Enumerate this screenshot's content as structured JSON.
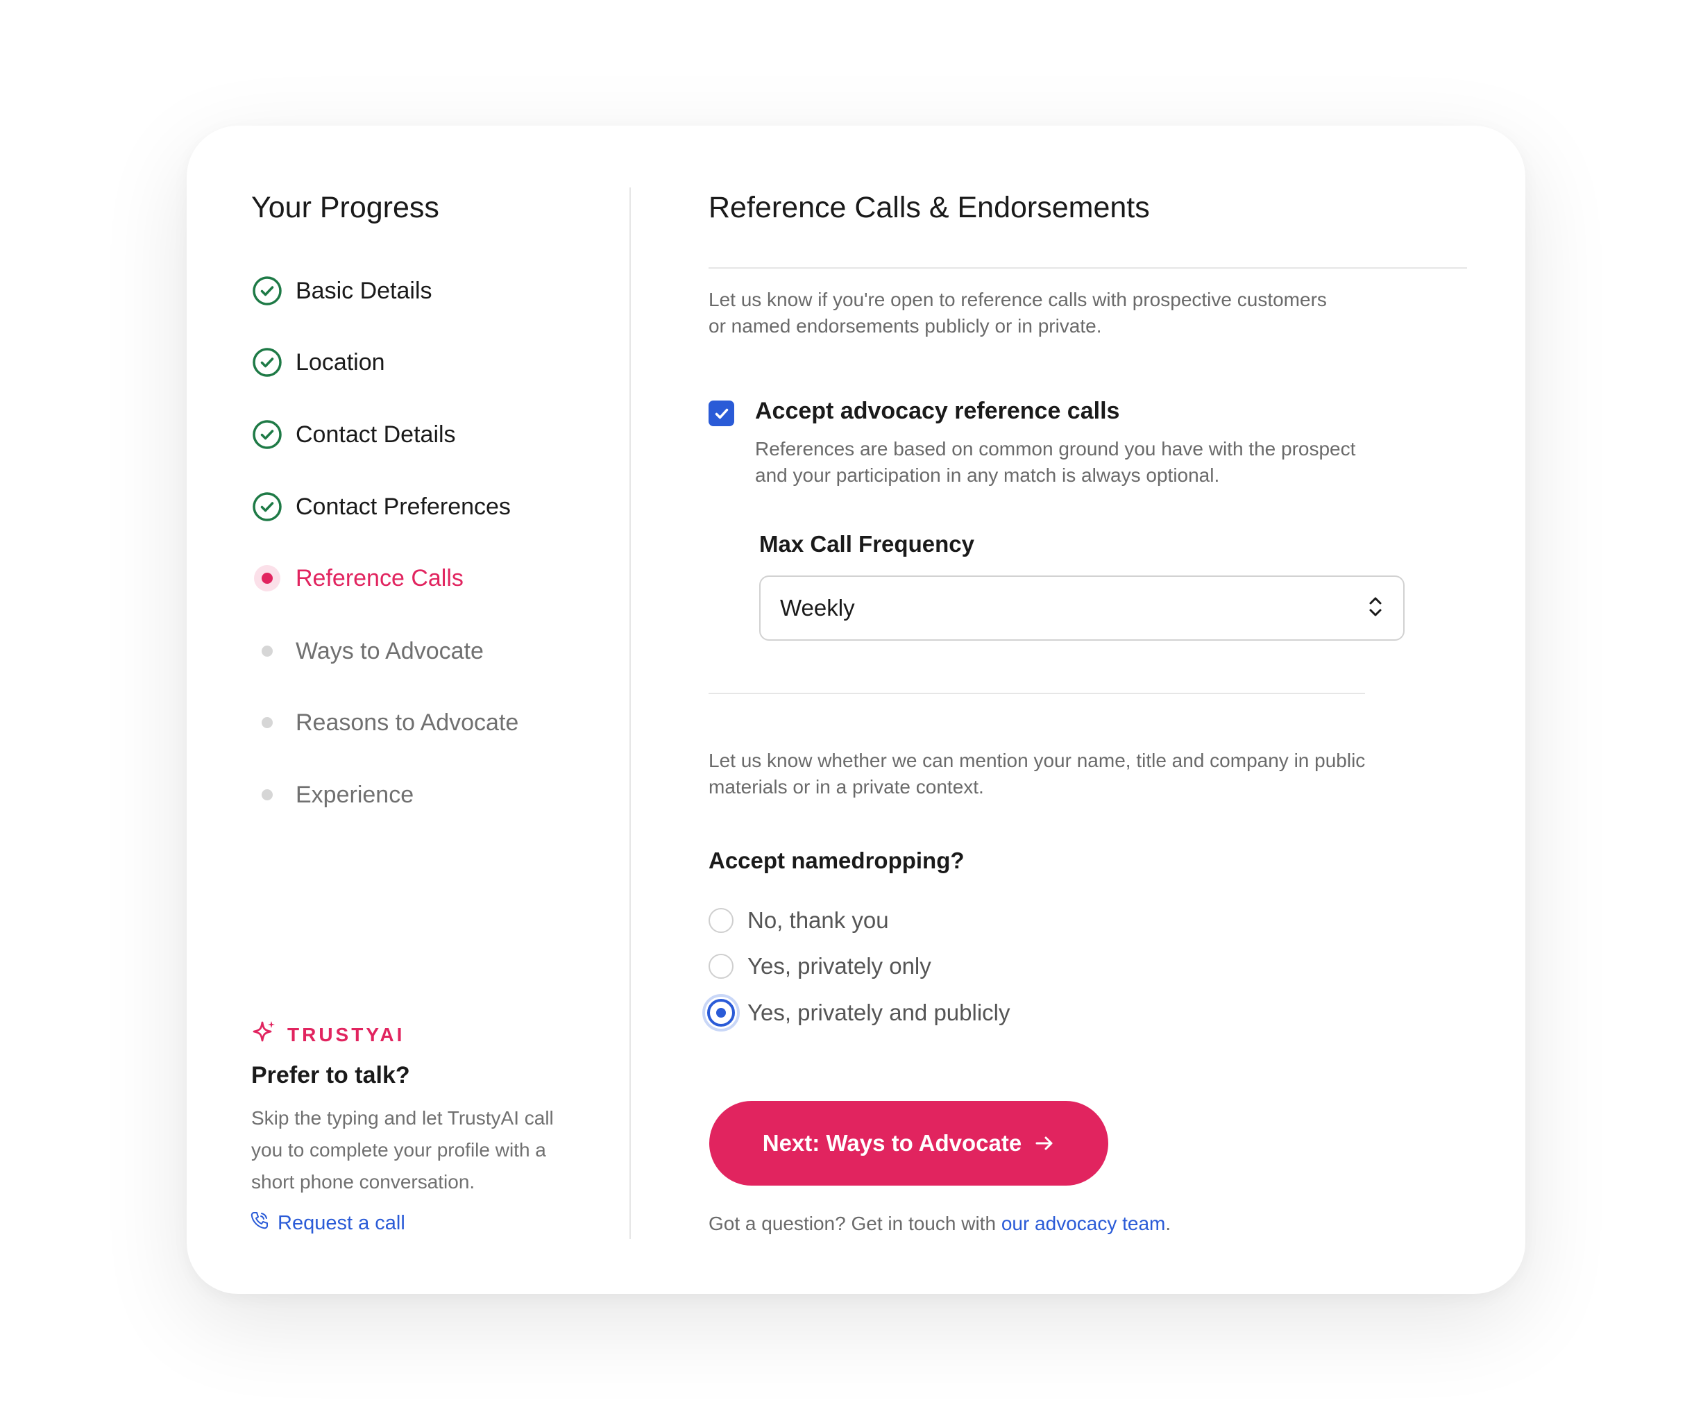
{
  "sidebar": {
    "title": "Your Progress",
    "steps": [
      {
        "label": "Basic Details",
        "status": "done"
      },
      {
        "label": "Location",
        "status": "done"
      },
      {
        "label": "Contact Details",
        "status": "done"
      },
      {
        "label": "Contact Preferences",
        "status": "done"
      },
      {
        "label": "Reference Calls",
        "status": "current"
      },
      {
        "label": "Ways to Advocate",
        "status": "pending"
      },
      {
        "label": "Reasons to Advocate",
        "status": "pending"
      },
      {
        "label": "Experience",
        "status": "pending"
      }
    ],
    "brand": "TRUSTYAI",
    "talk_title": "Prefer to talk?",
    "talk_text": "Skip the typing and let TrustyAI call you to complete your profile with a short phone conversation.",
    "request_call": "Request a call"
  },
  "main": {
    "title": "Reference Calls & Endorsements",
    "intro": "Let us know if you're open to reference calls with prospective customers or named endorsements publicly or in private.",
    "checkbox": {
      "label": "Accept advocacy reference calls",
      "checked": true,
      "help": "References are based on common ground you have with the prospect and your participation in any match is always optional."
    },
    "frequency": {
      "label": "Max Call Frequency",
      "value": "Weekly"
    },
    "namedrop_intro": "Let us know whether we can mention your name, title and company in public materials or in a private context.",
    "namedrop_question": "Accept namedropping?",
    "options": [
      {
        "label": "No, thank you",
        "selected": false
      },
      {
        "label": "Yes, privately only",
        "selected": false
      },
      {
        "label": "Yes, privately and publicly",
        "selected": true
      }
    ],
    "next_button": "Next: Ways to Advocate",
    "footer_text": "Got a question? Get in touch with ",
    "footer_link": "our advocacy team",
    "footer_end": "."
  },
  "colors": {
    "accent": "#e1245f",
    "link": "#2a5bd7",
    "done": "#1e7a46"
  }
}
